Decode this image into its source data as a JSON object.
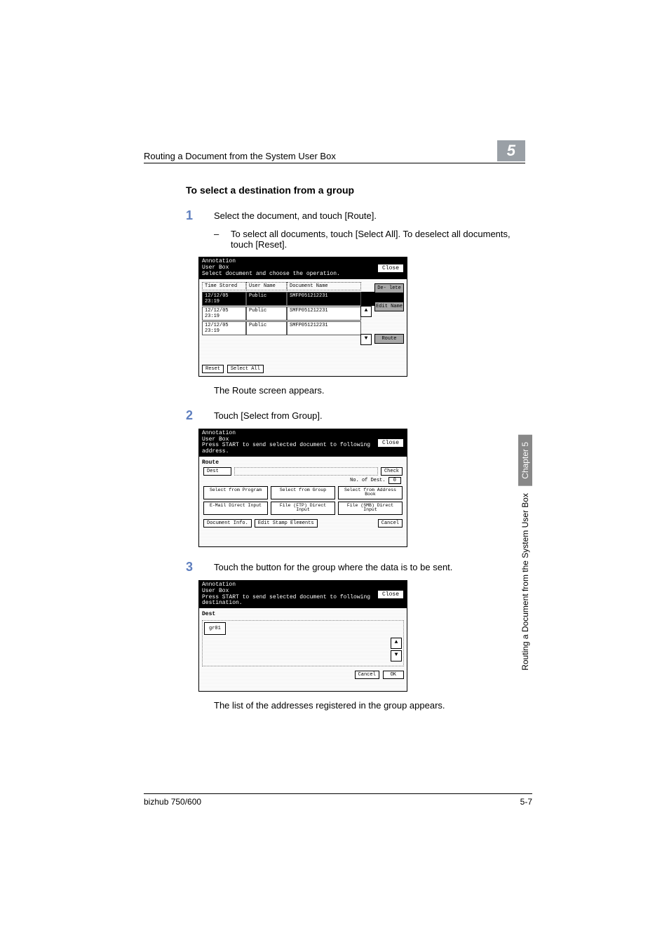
{
  "header": {
    "title": "Routing a Document from the System User Box",
    "chapter_num": "5"
  },
  "subheading": "To select a destination from a group",
  "steps": {
    "s1": {
      "num": "1",
      "text": "Select the document, and touch [Route]."
    },
    "s1_sub": "To select all documents, touch [Select All]. To deselect all documents, touch [Reset].",
    "s1_after": "The Route screen appears.",
    "s2": {
      "num": "2",
      "text": "Touch [Select from Group]."
    },
    "s3": {
      "num": "3",
      "text": "Touch the button for the group where the data is to be sent."
    },
    "s3_after": "The list of the addresses registered in the group appears."
  },
  "screen1": {
    "title1": "Annotation",
    "title2": "User Box",
    "instruction": "Select document and choose the operation.",
    "close": "Close",
    "col_time": "Time Stored",
    "col_user": "User Name",
    "col_doc": "Document Name",
    "rows": [
      {
        "time": "12/12/05 23:19",
        "user": "Public",
        "doc": "SMFP051212231"
      },
      {
        "time": "12/12/05 23:19",
        "user": "Public",
        "doc": "SMFP051212231"
      },
      {
        "time": "12/12/05 23:19",
        "user": "Public",
        "doc": "SMFP051212231"
      }
    ],
    "btn_delete": "De- lete",
    "btn_edit": "Edit Name",
    "btn_route": "Route",
    "reset": "Reset",
    "select_all": "Select All"
  },
  "screen2": {
    "title1": "Annotation",
    "title2": "User Box",
    "instruction": "Press START to send selected document to following address.",
    "close": "Close",
    "route": "Route",
    "dest": "Dest",
    "check": "Check",
    "noof": "No. of Dest.",
    "noof_val": "0",
    "btns": {
      "b1": "Select from Program",
      "b2": "Select from Group",
      "b3": "Select from Address Book",
      "b4": "E-Mail Direct Input",
      "b5": "File (FTP) Direct Input",
      "b6": "File (SMB) Direct Input"
    },
    "doc_info": "Document Info.",
    "edit_stamp": "Edit Stamp Elements",
    "cancel": "Cancel"
  },
  "screen3": {
    "title1": "Annotation",
    "title2": "User Box",
    "instruction": "Press START to send selected document to following destination.",
    "close": "Close",
    "dest": "Dest",
    "group": "gr01",
    "cancel": "Cancel",
    "ok": "OK"
  },
  "side": {
    "chapter": "Chapter 5",
    "title": "Routing a Document from the System User Box"
  },
  "footer": {
    "left": "bizhub 750/600",
    "right": "5-7"
  }
}
